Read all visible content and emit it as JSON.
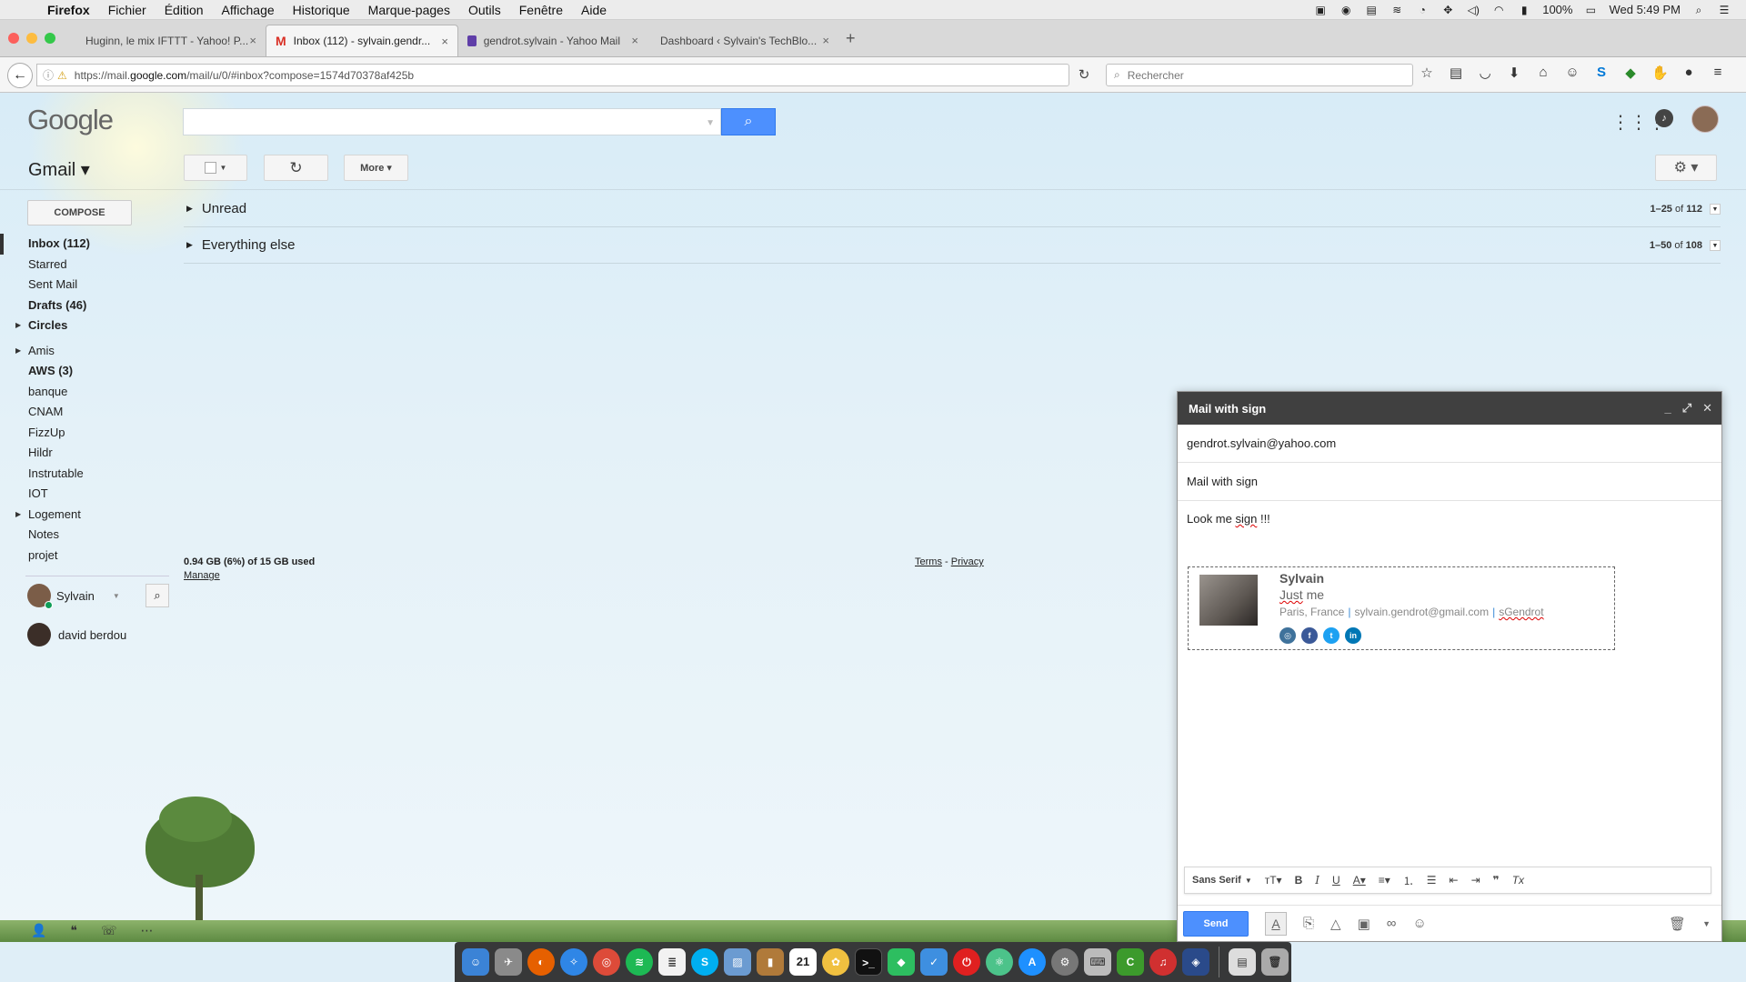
{
  "menubar": {
    "app": "Firefox",
    "items": [
      "Fichier",
      "Édition",
      "Affichage",
      "Historique",
      "Marque-pages",
      "Outils",
      "Fenêtre",
      "Aide"
    ],
    "battery": "100%",
    "clock": "Wed 5:49 PM"
  },
  "tabs": [
    {
      "label": "Huginn, le mix IFTTT - Yahoo! P...",
      "close": "×"
    },
    {
      "label": "Inbox (112) - sylvain.gendr...",
      "close": "×"
    },
    {
      "label": "gendrot.sylvain - Yahoo Mail",
      "close": "×"
    },
    {
      "label": "Dashboard ‹ Sylvain's TechBlo...",
      "close": "×"
    }
  ],
  "navbar": {
    "url_prefix": "https://mail.",
    "url_domain": "google.com",
    "url_rest": "/mail/u/0/#inbox?compose=1574d70378af425b",
    "search_placeholder": "Rechercher"
  },
  "gmail": {
    "logo": "Google",
    "label": "Gmail ▾",
    "more_label": "More ▾",
    "compose_label": "COMPOSE",
    "nav": [
      {
        "label": "Inbox (112)",
        "style": "sel"
      },
      {
        "label": "Starred",
        "style": ""
      },
      {
        "label": "Sent Mail",
        "style": ""
      },
      {
        "label": "Drafts (46)",
        "style": "bold"
      },
      {
        "label": "Circles",
        "style": "bold",
        "tri": true
      },
      {
        "label": "Amis",
        "style": "",
        "tri": true,
        "gap": true
      },
      {
        "label": "AWS (3)",
        "style": "bold"
      },
      {
        "label": "banque",
        "style": ""
      },
      {
        "label": "CNAM",
        "style": ""
      },
      {
        "label": "FizzUp",
        "style": ""
      },
      {
        "label": "Hildr",
        "style": ""
      },
      {
        "label": "Instrutable",
        "style": ""
      },
      {
        "label": "IOT",
        "style": ""
      },
      {
        "label": "Logement",
        "style": "",
        "tri": true
      },
      {
        "label": "Notes",
        "style": ""
      },
      {
        "label": "projet",
        "style": ""
      }
    ],
    "chat_user": "Sylvain",
    "chat_contact": "david berdou",
    "sections": [
      {
        "title": "Unread",
        "range": "1–25",
        "of": "of",
        "total": "112"
      },
      {
        "title": "Everything else",
        "range": "1–50",
        "of": "of",
        "total": "108"
      }
    ],
    "quota": "0.94 GB (6%) of 15 GB used",
    "manage": "Manage",
    "terms": "Terms",
    "privacy": "Privacy",
    "footer_sep": " - "
  },
  "compose": {
    "title": "Mail with sign",
    "to": "gendrot.sylvain@yahoo.com",
    "subject": "Mail with sign",
    "body_pre": "Look me ",
    "body_sq": "sign",
    "body_post": " !!!",
    "sig_name": "Sylvain",
    "sig_tag_sq": "Just",
    "sig_tag_rest": " me",
    "sig_location": "Paris, France",
    "sig_email": "sylvain.gendrot@gmail.com",
    "sig_handle": "sGendrot",
    "font": "Sans Serif",
    "send": "Send"
  },
  "dock_icons": [
    "finder-icon",
    "launchpad-icon",
    "firefox-icon",
    "safari-icon",
    "chrome-icon",
    "spotify-icon",
    "layers-icon",
    "skype-icon",
    "preview-icon",
    "books-icon",
    "calendar-icon",
    "photos-icon",
    "terminal-icon",
    "evernote-icon",
    "todo-icon",
    "power-icon",
    "atom-icon",
    "appstore-icon",
    "settings-icon",
    "keyboard-icon",
    "cura-icon",
    "headphones-icon",
    "virtualbox-icon"
  ],
  "calendar_day": "21",
  "colors": {
    "accent": "#4d90fe",
    "header": "#404040",
    "online": "#0f9d58"
  }
}
